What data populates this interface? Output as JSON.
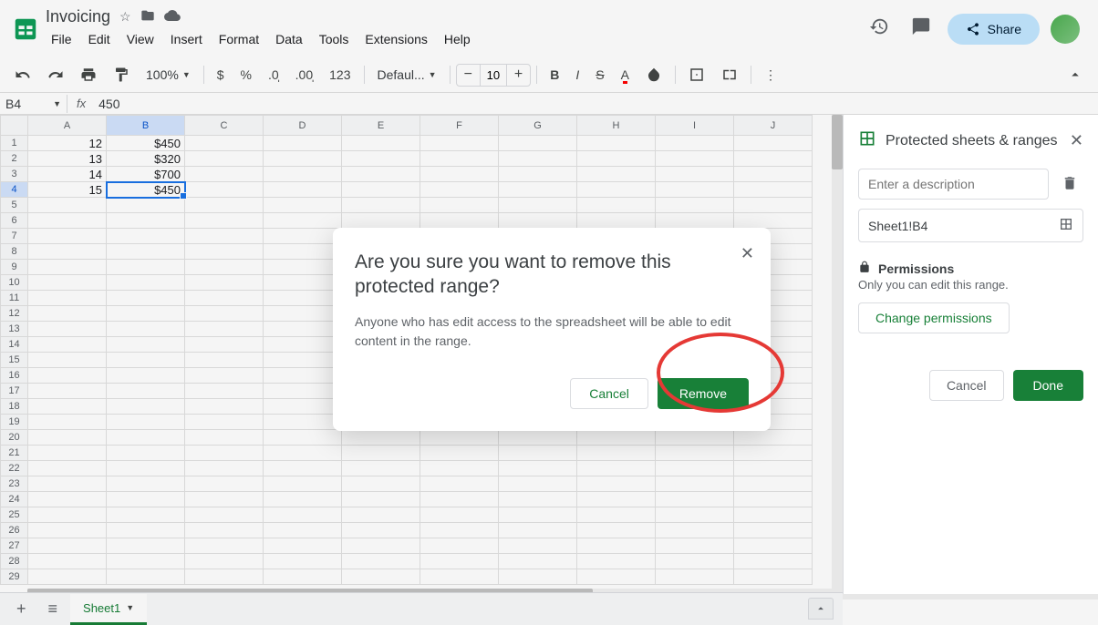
{
  "doc": {
    "title": "Invoicing"
  },
  "menus": [
    "File",
    "Edit",
    "View",
    "Insert",
    "Format",
    "Data",
    "Tools",
    "Extensions",
    "Help"
  ],
  "share_label": "Share",
  "toolbar": {
    "zoom": "100%",
    "font": "Defaul...",
    "font_size": "10"
  },
  "formula_bar": {
    "cell_ref": "B4",
    "formula": "450"
  },
  "columns": [
    "A",
    "B",
    "C",
    "D",
    "E",
    "F",
    "G",
    "H",
    "I",
    "J"
  ],
  "selected_col_idx": 1,
  "selected_row_idx": 3,
  "rows": 29,
  "cells": {
    "r0": {
      "A": "12",
      "B": "$450"
    },
    "r1": {
      "A": "13",
      "B": "$320"
    },
    "r2": {
      "A": "14",
      "B": "$700"
    },
    "r3": {
      "A": "15",
      "B": "$450"
    }
  },
  "sidepanel": {
    "title": "Protected sheets & ranges",
    "desc_placeholder": "Enter a description",
    "range": "Sheet1!B4",
    "permissions_label": "Permissions",
    "permissions_desc": "Only you can edit this range.",
    "change_btn": "Change permissions",
    "cancel": "Cancel",
    "done": "Done"
  },
  "modal": {
    "title": "Are you sure you want to remove this protected range?",
    "body": "Anyone who has edit access to the spreadsheet will be able to edit content in the range.",
    "cancel": "Cancel",
    "remove": "Remove"
  },
  "tabs": {
    "sheet1": "Sheet1"
  }
}
